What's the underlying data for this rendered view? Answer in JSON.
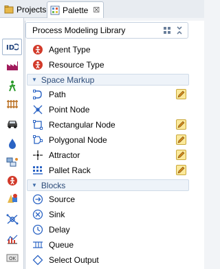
{
  "tabs": {
    "projects": "Projects",
    "palette": "Palette",
    "palette_close": "☒"
  },
  "panel": {
    "title": "Process Modeling Library"
  },
  "items_top": [
    {
      "label": "Agent Type",
      "icon": "agent-type-icon"
    },
    {
      "label": "Resource Type",
      "icon": "resource-type-icon"
    }
  ],
  "sections": {
    "space_markup": "Space Markup",
    "blocks": "Blocks"
  },
  "space_markup_items": [
    {
      "label": "Path",
      "icon": "path-icon",
      "editable": true
    },
    {
      "label": "Point Node",
      "icon": "point-node-icon",
      "editable": false
    },
    {
      "label": "Rectangular Node",
      "icon": "rectangular-node-icon",
      "editable": true
    },
    {
      "label": "Polygonal Node",
      "icon": "polygonal-node-icon",
      "editable": true
    },
    {
      "label": "Attractor",
      "icon": "attractor-icon",
      "editable": true
    },
    {
      "label": "Pallet Rack",
      "icon": "pallet-rack-icon",
      "editable": true
    }
  ],
  "block_items": [
    {
      "label": "Source",
      "icon": "source-icon"
    },
    {
      "label": "Sink",
      "icon": "sink-icon"
    },
    {
      "label": "Delay",
      "icon": "delay-icon"
    },
    {
      "label": "Queue",
      "icon": "queue-icon"
    },
    {
      "label": "Select Output",
      "icon": "select-output-icon"
    }
  ],
  "strip_icons": [
    "process-library-icon",
    "factory-icon",
    "pedestrian-icon",
    "rail-icon",
    "road-traffic-icon",
    "fluid-icon",
    "agent-icon",
    "person-icon",
    "presentation-icon",
    "space-markup-icon",
    "analysis-icon",
    "controls-icon"
  ],
  "colors": {
    "accent": "#2b4a78",
    "pencil": "#fbe99b",
    "agent_red": "#d23a2a"
  }
}
